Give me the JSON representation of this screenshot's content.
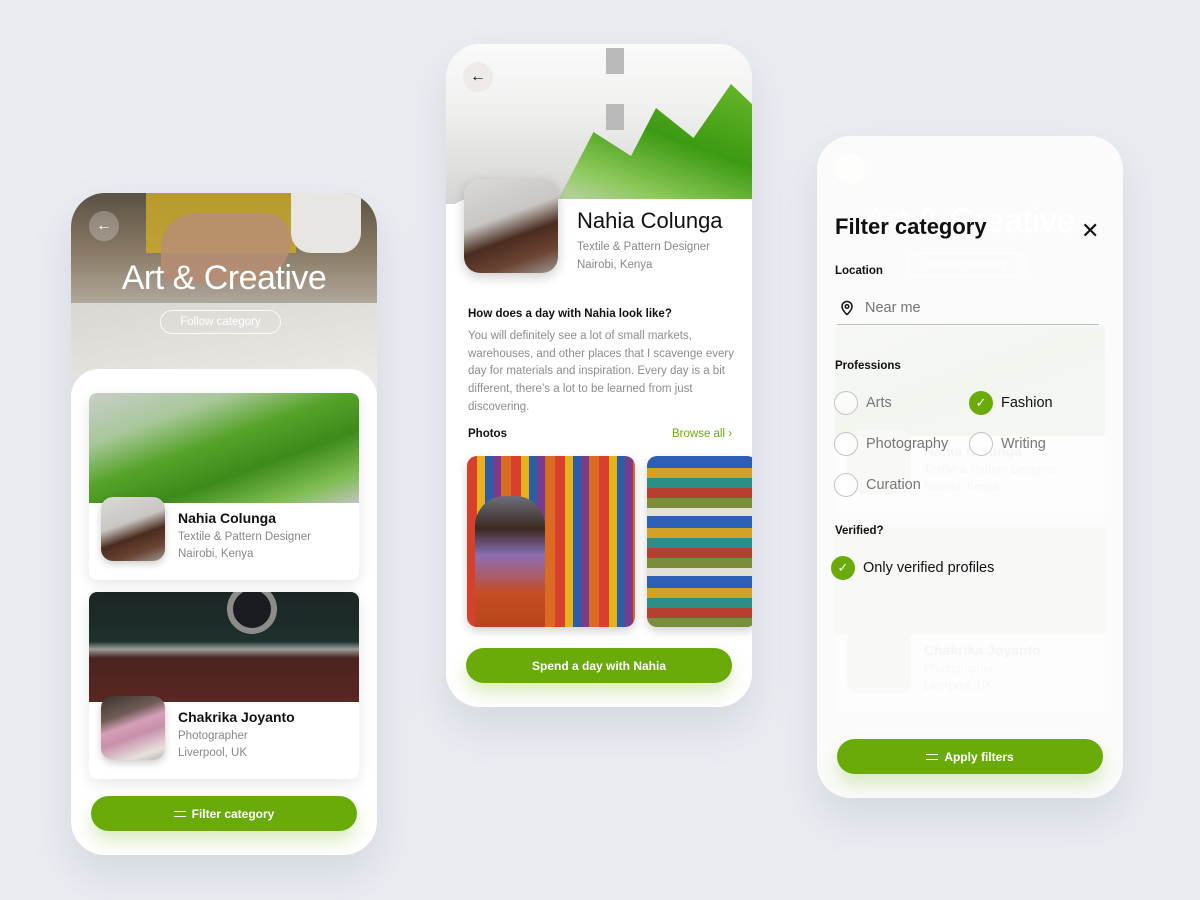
{
  "screen1": {
    "back_icon": "arrow-left-icon",
    "title": "Art & Creative",
    "follow_label": "Follow category",
    "cards": [
      {
        "name": "Nahia Colunga",
        "role": "Textile & Pattern Designer",
        "location": "Nairobi, Kenya"
      },
      {
        "name": "Chakrika Joyanto",
        "role": "Photographer",
        "location": "Liverpool, UK"
      }
    ],
    "filter_label": "Filter category"
  },
  "screen2": {
    "back_icon": "arrow-left-icon",
    "name": "Nahia Colunga",
    "role": "Textile & Pattern Designer",
    "location": "Nairobi, Kenya",
    "question": "How does a day with Nahia look like?",
    "description": "You will definitely see a lot of small markets, warehouses, and other places that I scavenge every day for materials and inspiration. Every day is a bit different, there’s a lot to be learned from just discovering.",
    "photos_label": "Photos",
    "browse_label": "Browse all ›",
    "cta_label": "Spend a day with Nahia"
  },
  "screen3": {
    "title": "Filter category",
    "close_icon": "close-icon",
    "location_label": "Location",
    "location_placeholder": "Near me",
    "professions_label": "Professions",
    "professions": [
      {
        "label": "Arts",
        "checked": false
      },
      {
        "label": "Fashion",
        "checked": true
      },
      {
        "label": "Photography",
        "checked": false
      },
      {
        "label": "Writing",
        "checked": false
      },
      {
        "label": "Curation",
        "checked": false
      }
    ],
    "verified_label": "Verified?",
    "verified_option": {
      "label": "Only verified profiles",
      "checked": true
    },
    "apply_label": "Apply filters",
    "background": {
      "title": "Art & Creative",
      "follow_label": "Follow category",
      "cards": [
        {
          "name": "Nahia Colunga",
          "role": "Textile & Pattern Designer",
          "location": "Nairobi, Kenya"
        },
        {
          "name": "Chakrika Joyanto",
          "role": "Photographer",
          "location": "Liverpool, UK"
        }
      ]
    }
  },
  "colors": {
    "accent": "#6aab0a",
    "background": "#e9ecf1",
    "text_primary": "#111111",
    "text_secondary": "#888888"
  }
}
